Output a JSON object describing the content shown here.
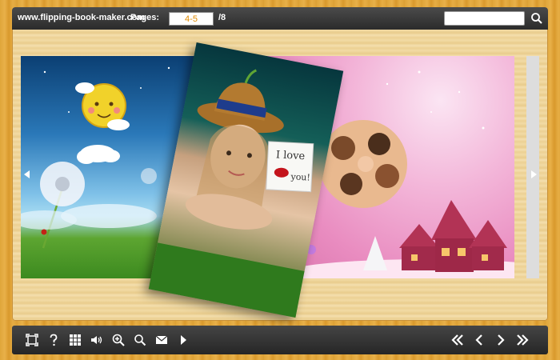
{
  "topbar": {
    "site_name": "www.flipping-book-maker.com",
    "pages_label": "Pages:",
    "current_pages": "4-5",
    "total_pages": "/8",
    "search_placeholder": ""
  },
  "book": {
    "note_line1": "I love",
    "note_line2": "you!"
  },
  "toolbar": {
    "left_items": [
      "fullscreen-icon",
      "help-icon",
      "thumbnails-icon",
      "sound-icon",
      "zoom-in-icon",
      "search-icon",
      "email-icon",
      "autoplay-icon"
    ],
    "right_items": [
      "first-page-icon",
      "previous-page-icon",
      "next-page-icon",
      "last-page-icon"
    ]
  },
  "colors": {
    "bar": "#2b2b2b",
    "page_number": "#e08a00",
    "wood": "#e0a63a"
  }
}
